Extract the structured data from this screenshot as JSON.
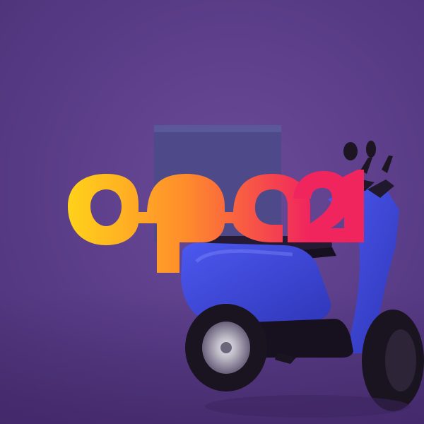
{
  "logo": {
    "text": "opa21",
    "gradient": [
      "#ffd21a",
      "#ff7a2d",
      "#f0245e"
    ]
  },
  "scene": {
    "background_color": "#5d3f8b",
    "scooter_color": "#3f47d8",
    "box_color": "#4e4a8a",
    "tire_color": "#1a1320"
  }
}
